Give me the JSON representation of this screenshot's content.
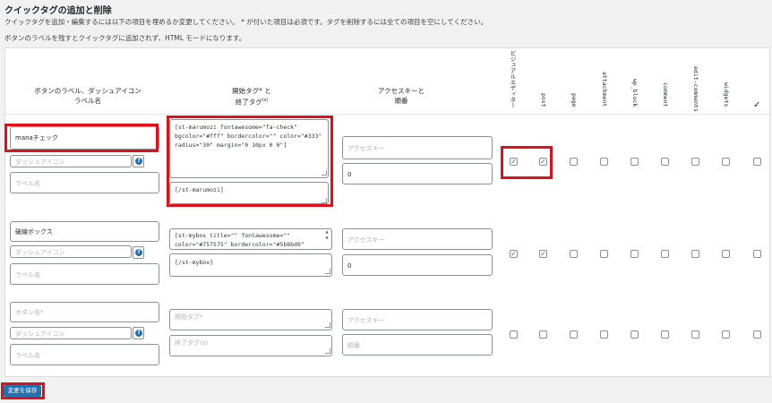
{
  "page": {
    "title": "クイックタグの追加と削除",
    "desc1": "クイックタグを追加・編集するには以下の項目を埋めるか変更してください。 * が付いた項目は必須です。タグを削除するには全ての項目を空にしてください。",
    "desc2": "ボタンのラベルを残すとクイックタグに追加されず、HTML モードになります。"
  },
  "headers": {
    "col1_line1": "ボタンのラベル、ダッシュアイコン",
    "col1_line2": "ラベル名",
    "col2_line1": "開始タグ* と",
    "col2_line2": "終了タグ",
    "col2_sup": "(s)",
    "col3_line1": "アクセスキーと",
    "col3_line2": "順番",
    "visual": "ビジュアルエディター",
    "post": "post",
    "page": "page",
    "attachment": "attachment",
    "wp_block": "wp_block",
    "comment": "comment",
    "edit_comments": "edit-comments",
    "widgets": "widgets",
    "check_all": "✓"
  },
  "rows": [
    {
      "button_label": "manaチェック",
      "dashicon_ph": "ダッシュアイコン",
      "label_name_ph": "ラベル名",
      "start_tag": "[st-marumozi fontawesome=\"fa-check\"\nbgcolor=\"#fff\" bordercolor=\"\" color=\"#333\"\nradius=\"30\" margin=\"0 10px 0 0\"]",
      "end_tag": "[/st-marumozi]",
      "access_key_ph": "アクセスキー",
      "order": "0",
      "checks": [
        true,
        true,
        false,
        false,
        false,
        false,
        false,
        false,
        false
      ]
    },
    {
      "button_label": "破線ボックス",
      "dashicon_ph": "ダッシュアイコン",
      "label_name_ph": "ラベル名",
      "start_tag": "[st-mybox title=\"\" fontawesome=\"\"\ncolor=\"#757575\" bordercolor=\"#5b8bd0\"",
      "end_tag": "[/st-mybox]",
      "access_key_ph": "アクセスキー",
      "order": "0",
      "checks": [
        true,
        true,
        false,
        false,
        false,
        false,
        false,
        false,
        false
      ]
    },
    {
      "button_label_ph": "ボタン名*",
      "dashicon_ph": "ダッシュアイコン",
      "label_name_ph": "ラベル名",
      "start_tag_ph": "開始タグ*",
      "end_tag_ph": "終了タグ(s)",
      "access_key_ph": "アクセスキー",
      "order_ph": "順番",
      "checks": [
        false,
        false,
        false,
        false,
        false,
        false,
        false,
        false,
        false
      ]
    }
  ],
  "help_glyph": "?",
  "check_glyph": "✓",
  "save_button": "変更を保存"
}
